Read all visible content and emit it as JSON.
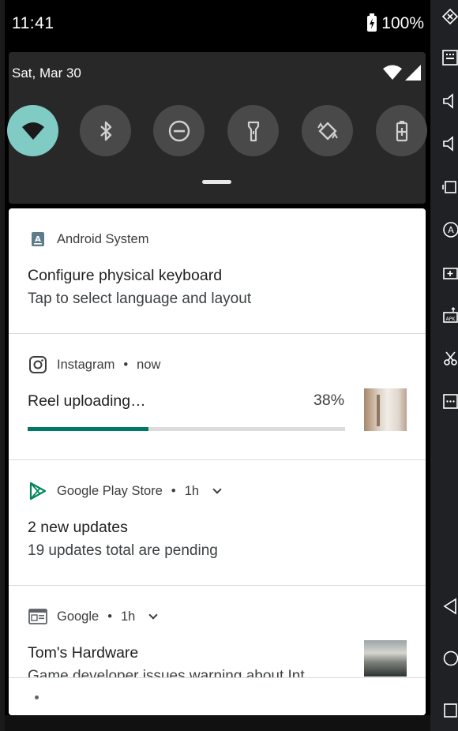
{
  "status_bar": {
    "time": "11:41",
    "battery": "100%"
  },
  "quick_settings": {
    "date": "Sat, Mar 30",
    "tiles": [
      {
        "name": "wifi",
        "active": true
      },
      {
        "name": "bluetooth",
        "active": false
      },
      {
        "name": "do-not-disturb",
        "active": false
      },
      {
        "name": "flashlight",
        "active": false
      },
      {
        "name": "auto-rotate",
        "active": false
      },
      {
        "name": "battery-saver",
        "active": false
      }
    ]
  },
  "notifications": {
    "android_system": {
      "app": "Android System",
      "title": "Configure physical keyboard",
      "text": "Tap to select language and layout"
    },
    "instagram": {
      "app": "Instagram",
      "time": "now",
      "title": "Reel uploading…",
      "percent": "38%",
      "progress": 0.38
    },
    "play_store": {
      "app": "Google Play Store",
      "time": "1h",
      "title": "2 new updates",
      "text": "19 updates total are pending"
    },
    "google": {
      "app": "Google",
      "time": "1h",
      "title": "Tom's Hardware",
      "text": "Game developer issues warning about Int"
    }
  },
  "colors": {
    "accent_tile": "#80cbc4",
    "progress": "#00796b",
    "panel": "#282828"
  }
}
